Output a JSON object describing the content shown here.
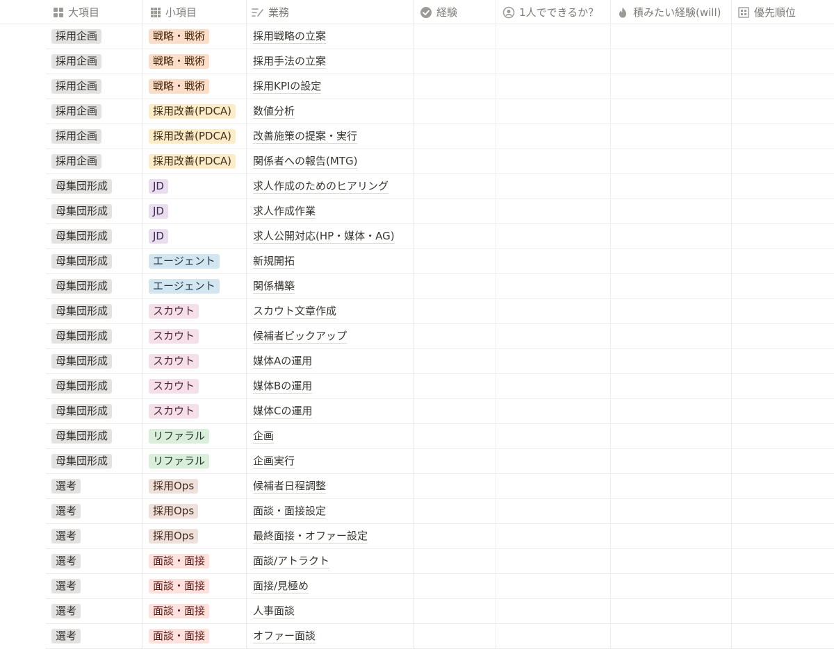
{
  "columns": {
    "major": {
      "label": "大項目",
      "icon": "grid-icon"
    },
    "minor": {
      "label": "小項目",
      "icon": "grid-icon"
    },
    "task": {
      "label": "業務",
      "icon": "pencil-lines-icon"
    },
    "experience": {
      "label": "経験",
      "icon": "check-badge-icon"
    },
    "solo": {
      "label": "1人でできるか？",
      "icon": "person-circle-icon"
    },
    "will": {
      "label": "積みたい経験(will)",
      "icon": "flame-icon"
    },
    "priority": {
      "label": "優先順位",
      "icon": "formula-icon"
    }
  },
  "tag_colors": {
    "gray": {
      "bg": "#e3e2e0",
      "fg": "#32302c"
    },
    "orange": {
      "bg": "#fadec9",
      "fg": "#49290e"
    },
    "yellow": {
      "bg": "#fdecc8",
      "fg": "#402c1b"
    },
    "purple": {
      "bg": "#e8deee",
      "fg": "#412454"
    },
    "blue": {
      "bg": "#d3e5ef",
      "fg": "#183347"
    },
    "pink": {
      "bg": "#f5e0e9",
      "fg": "#4c2337"
    },
    "green": {
      "bg": "#dbeddb",
      "fg": "#1c3829"
    },
    "brown": {
      "bg": "#eee0da",
      "fg": "#442a1e"
    },
    "red": {
      "bg": "#ffe2dd",
      "fg": "#5d1715"
    }
  },
  "rows": [
    {
      "major": "採用企画",
      "minor": "戦略・戦術",
      "minor_color": "orange",
      "task": "採用戦略の立案"
    },
    {
      "major": "採用企画",
      "minor": "戦略・戦術",
      "minor_color": "orange",
      "task": "採用手法の立案"
    },
    {
      "major": "採用企画",
      "minor": "戦略・戦術",
      "minor_color": "orange",
      "task": "採用KPIの設定"
    },
    {
      "major": "採用企画",
      "minor": "採用改善(PDCA)",
      "minor_color": "yellow",
      "task": "数値分析"
    },
    {
      "major": "採用企画",
      "minor": "採用改善(PDCA)",
      "minor_color": "yellow",
      "task": "改善施策の提案・実行"
    },
    {
      "major": "採用企画",
      "minor": "採用改善(PDCA)",
      "minor_color": "yellow",
      "task": "関係者への報告(MTG)"
    },
    {
      "major": "母集団形成",
      "minor": "JD",
      "minor_color": "purple",
      "task": "求人作成のためのヒアリング"
    },
    {
      "major": "母集団形成",
      "minor": "JD",
      "minor_color": "purple",
      "task": "求人作成作業"
    },
    {
      "major": "母集団形成",
      "minor": "JD",
      "minor_color": "purple",
      "task": "求人公開対応(HP・媒体・AG)"
    },
    {
      "major": "母集団形成",
      "minor": "エージェント",
      "minor_color": "blue",
      "task": "新規開拓"
    },
    {
      "major": "母集団形成",
      "minor": "エージェント",
      "minor_color": "blue",
      "task": "関係構築"
    },
    {
      "major": "母集団形成",
      "minor": "スカウト",
      "minor_color": "pink",
      "task": "スカウト文章作成"
    },
    {
      "major": "母集団形成",
      "minor": "スカウト",
      "minor_color": "pink",
      "task": "候補者ピックアップ"
    },
    {
      "major": "母集団形成",
      "minor": "スカウト",
      "minor_color": "pink",
      "task": "媒体Aの運用"
    },
    {
      "major": "母集団形成",
      "minor": "スカウト",
      "minor_color": "pink",
      "task": "媒体Bの運用"
    },
    {
      "major": "母集団形成",
      "minor": "スカウト",
      "minor_color": "pink",
      "task": "媒体Cの運用"
    },
    {
      "major": "母集団形成",
      "minor": "リファラル",
      "minor_color": "green",
      "task": "企画"
    },
    {
      "major": "母集団形成",
      "minor": "リファラル",
      "minor_color": "green",
      "task": "企画実行"
    },
    {
      "major": "選考",
      "minor": "採用Ops",
      "minor_color": "brown",
      "task": "候補者日程調整"
    },
    {
      "major": "選考",
      "minor": "採用Ops",
      "minor_color": "brown",
      "task": "面談・面接設定"
    },
    {
      "major": "選考",
      "minor": "採用Ops",
      "minor_color": "brown",
      "task": "最終面接・オファー設定"
    },
    {
      "major": "選考",
      "minor": "面談・面接",
      "minor_color": "red",
      "task": "面談/アトラクト"
    },
    {
      "major": "選考",
      "minor": "面談・面接",
      "minor_color": "red",
      "task": "面接/見極め"
    },
    {
      "major": "選考",
      "minor": "面談・面接",
      "minor_color": "red",
      "task": "人事面談"
    },
    {
      "major": "選考",
      "minor": "面談・面接",
      "minor_color": "red",
      "task": "オファー面談"
    }
  ]
}
